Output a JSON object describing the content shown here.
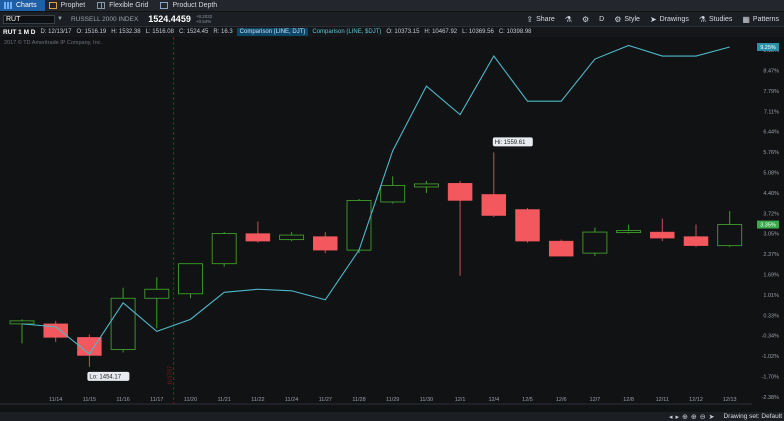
{
  "tabs": [
    {
      "label": "Charts",
      "icon": "bar-chart-icon",
      "active": true
    },
    {
      "label": "Prophet",
      "icon": "prophet-icon",
      "active": false
    },
    {
      "label": "Flexible Grid",
      "icon": "grid-icon",
      "active": false
    },
    {
      "label": "Product Depth",
      "icon": "depth-icon",
      "active": false
    }
  ],
  "toolbar": {
    "symbol": "RUT",
    "instrument_name": "RUSSELL 2000 INDEX",
    "last_price": "1524.4459",
    "change_1": "+8.2032",
    "change_2": "+0.54%",
    "share": "Share",
    "aggregation": "D",
    "style": "Style",
    "drawings": "Drawings",
    "studies": "Studies",
    "patterns": "Patterns"
  },
  "info": {
    "symbol_period": "RUT 1 M D",
    "date": "D: 12/13/17",
    "open": "O: 1516.19",
    "high": "H: 1532.38",
    "low": "L: 1516.08",
    "close": "C: 1524.45",
    "range": "R: 16.3",
    "comparison_1": "Comparison (LINE, DJT)",
    "comparison_2": "Comparison (LINE, $DJT)",
    "cmp_open": "O: 10373.15",
    "cmp_high": "H: 10467.92",
    "cmp_low": "L: 10369.56",
    "cmp_close": "C: 10398.98"
  },
  "copyright": "2017 © TD Ameritrade IP Company, Inc.",
  "status": {
    "drawing_set": "Drawing set: Default"
  },
  "colors": {
    "up": "#3f9e2a",
    "down": "#f2585e",
    "comparison": "#4fb8c8",
    "grid": "#2a2e33",
    "badge_line": "#2a8fa6",
    "badge_price": "#3aa84c"
  },
  "chart_data": {
    "type": "candlestick",
    "x_categories": [
      "11/14",
      "11/15",
      "11/16",
      "11/17",
      "11/20",
      "11/21",
      "11/22",
      "11/24",
      "11/27",
      "11/28",
      "11/29",
      "11/30",
      "12/1",
      "12/4",
      "12/5",
      "12/6",
      "12/7",
      "12/8",
      "12/11",
      "12/12",
      "12/13"
    ],
    "y_axis_labels": [
      "9.15%",
      "8.47%",
      "7.79%",
      "7.11%",
      "6.44%",
      "5.76%",
      "5.08%",
      "4.40%",
      "3.72%",
      "3.05%",
      "2.37%",
      "1.69%",
      "1.01%",
      "0.33%",
      "-0.34%",
      "-1.02%",
      "-1.70%",
      "-2.38%"
    ],
    "ylim": [
      -2.38,
      9.6
    ],
    "candles": [
      {
        "date": "11/13",
        "o": 0.05,
        "h": 0.2,
        "l": -0.6,
        "c": 0.15
      },
      {
        "date": "11/14",
        "o": 0.05,
        "h": 0.15,
        "l": -0.55,
        "c": -0.4
      },
      {
        "date": "11/15",
        "o": -0.4,
        "h": -0.3,
        "l": -1.38,
        "c": -1.0
      },
      {
        "date": "11/16",
        "o": -0.8,
        "h": 1.25,
        "l": -0.9,
        "c": 0.9
      },
      {
        "date": "11/17",
        "o": 0.9,
        "h": 1.6,
        "l": -0.1,
        "c": 1.2
      },
      {
        "date": "11/20",
        "o": 1.05,
        "h": 2.05,
        "l": 0.9,
        "c": 2.05
      },
      {
        "date": "11/21",
        "o": 2.05,
        "h": 3.1,
        "l": 1.95,
        "c": 3.05
      },
      {
        "date": "11/22",
        "o": 3.05,
        "h": 3.45,
        "l": 2.75,
        "c": 2.8
      },
      {
        "date": "11/24",
        "o": 2.85,
        "h": 3.1,
        "l": 2.8,
        "c": 3.0
      },
      {
        "date": "11/27",
        "o": 2.95,
        "h": 3.1,
        "l": 2.4,
        "c": 2.5
      },
      {
        "date": "11/28",
        "o": 2.5,
        "h": 4.2,
        "l": 2.4,
        "c": 4.15
      },
      {
        "date": "11/29",
        "o": 4.1,
        "h": 4.95,
        "l": 4.05,
        "c": 4.65
      },
      {
        "date": "11/30",
        "o": 4.6,
        "h": 4.8,
        "l": 4.4,
        "c": 4.7
      },
      {
        "date": "12/1",
        "o": 4.72,
        "h": 4.8,
        "l": 1.65,
        "c": 4.15
      },
      {
        "date": "12/4",
        "o": 4.35,
        "h": 5.75,
        "l": 3.6,
        "c": 3.65
      },
      {
        "date": "12/5",
        "o": 3.85,
        "h": 3.9,
        "l": 2.75,
        "c": 2.8
      },
      {
        "date": "12/6",
        "o": 2.8,
        "h": 2.85,
        "l": 2.3,
        "c": 2.3
      },
      {
        "date": "12/7",
        "o": 2.4,
        "h": 3.25,
        "l": 2.3,
        "c": 3.1
      },
      {
        "date": "12/8",
        "o": 3.1,
        "h": 3.35,
        "l": 3.05,
        "c": 3.15
      },
      {
        "date": "12/11",
        "o": 3.1,
        "h": 3.55,
        "l": 2.8,
        "c": 2.9
      },
      {
        "date": "12/12",
        "o": 2.95,
        "h": 3.35,
        "l": 2.6,
        "c": 2.65
      },
      {
        "date": "12/13",
        "o": 2.65,
        "h": 3.8,
        "l": 2.6,
        "c": 3.35
      }
    ],
    "comparison_series": [
      {
        "date": "11/13",
        "v": 0.05
      },
      {
        "date": "11/14",
        "v": -0.05
      },
      {
        "date": "11/15",
        "v": -0.95
      },
      {
        "date": "11/16",
        "v": 0.75
      },
      {
        "date": "11/17",
        "v": -0.2
      },
      {
        "date": "11/20",
        "v": 0.2
      },
      {
        "date": "11/21",
        "v": 1.1
      },
      {
        "date": "11/22",
        "v": 1.2
      },
      {
        "date": "11/24",
        "v": 1.15
      },
      {
        "date": "11/27",
        "v": 0.85
      },
      {
        "date": "11/28",
        "v": 2.5
      },
      {
        "date": "11/29",
        "v": 5.8
      },
      {
        "date": "11/30",
        "v": 7.95
      },
      {
        "date": "12/1",
        "v": 7.0
      },
      {
        "date": "12/4",
        "v": 8.95
      },
      {
        "date": "12/5",
        "v": 7.45
      },
      {
        "date": "12/6",
        "v": 7.45
      },
      {
        "date": "12/7",
        "v": 8.85
      },
      {
        "date": "12/8",
        "v": 9.3
      },
      {
        "date": "12/11",
        "v": 8.95
      },
      {
        "date": "12/12",
        "v": 8.95
      },
      {
        "date": "12/13",
        "v": 9.25
      }
    ],
    "hi_label": "Hi: 1559.61",
    "hi_index": 14,
    "hi_value": 5.75,
    "lo_label": "Lo: 1454.17",
    "lo_index": 2,
    "lo_value": -1.38,
    "divider_label": "11/17/17",
    "divider_after_index": 4,
    "last_comparison_badge": "9.25%",
    "last_price_badge": "3.35%",
    "grid": false
  }
}
